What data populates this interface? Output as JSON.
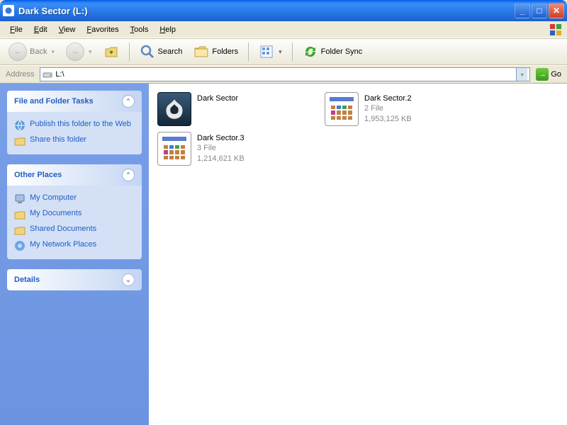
{
  "window": {
    "title": "Dark Sector (L:)"
  },
  "menubar": {
    "items": [
      "File",
      "Edit",
      "View",
      "Favorites",
      "Tools",
      "Help"
    ]
  },
  "toolbar": {
    "back": "Back",
    "search": "Search",
    "folders": "Folders",
    "foldersync": "Folder Sync"
  },
  "addressbar": {
    "label": "Address",
    "value": "L:\\",
    "go": "Go"
  },
  "sidebar": {
    "tasks": {
      "title": "File and Folder Tasks",
      "items": [
        {
          "label": "Publish this folder to the Web"
        },
        {
          "label": "Share this folder"
        }
      ]
    },
    "places": {
      "title": "Other Places",
      "items": [
        {
          "label": "My Computer"
        },
        {
          "label": "My Documents"
        },
        {
          "label": "Shared Documents"
        },
        {
          "label": "My Network Places"
        }
      ]
    },
    "details": {
      "title": "Details"
    }
  },
  "files": [
    {
      "name": "Dark Sector",
      "type": "",
      "size": "",
      "icon": "dark"
    },
    {
      "name": "Dark Sector.2",
      "type": "2 File",
      "size": "1,953,125 KB",
      "icon": "doc"
    },
    {
      "name": "Dark Sector.3",
      "type": "3 File",
      "size": "1,214,621 KB",
      "icon": "doc"
    }
  ]
}
